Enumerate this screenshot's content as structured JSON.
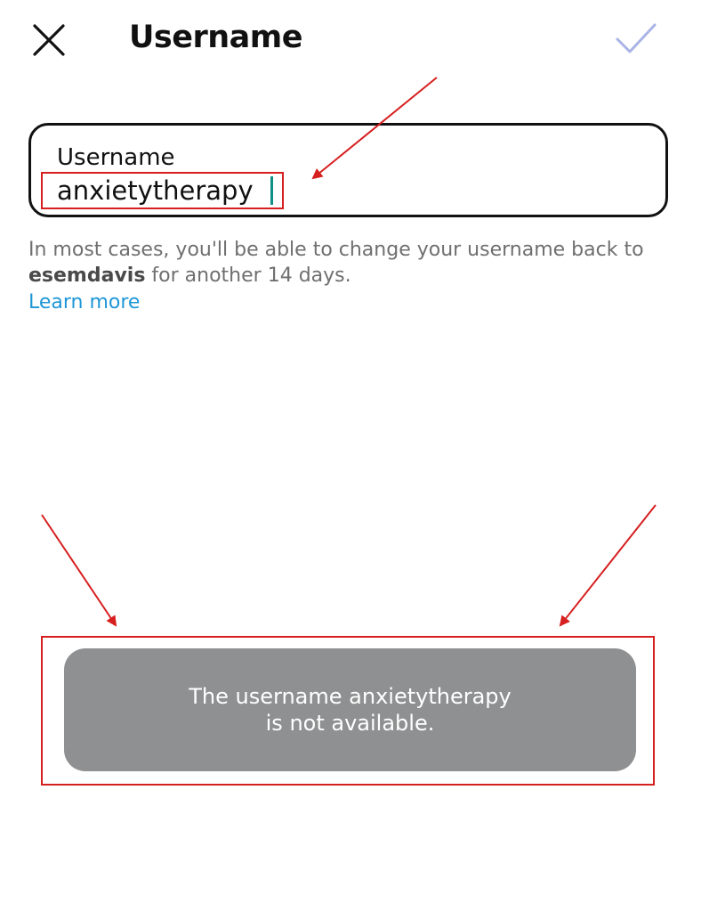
{
  "header": {
    "title": "Username",
    "close_icon": "close-icon",
    "confirm_icon": "checkmark-icon"
  },
  "username_field": {
    "label": "Username",
    "value": "anxietytherapy"
  },
  "helper": {
    "text_before": "In most cases, you'll be able to change your username back to ",
    "previous_username": "esemdavis",
    "text_after": " for another 14 days.",
    "learn_more": "Learn more"
  },
  "toast": {
    "message": "The username anxietytherapy is not available."
  },
  "colors": {
    "link": "#1f97d6",
    "caret": "#0f8f86",
    "toast_bg": "#8f9091",
    "confirm_disabled": "#a9b3e6",
    "annotation": "#d61f1f"
  }
}
